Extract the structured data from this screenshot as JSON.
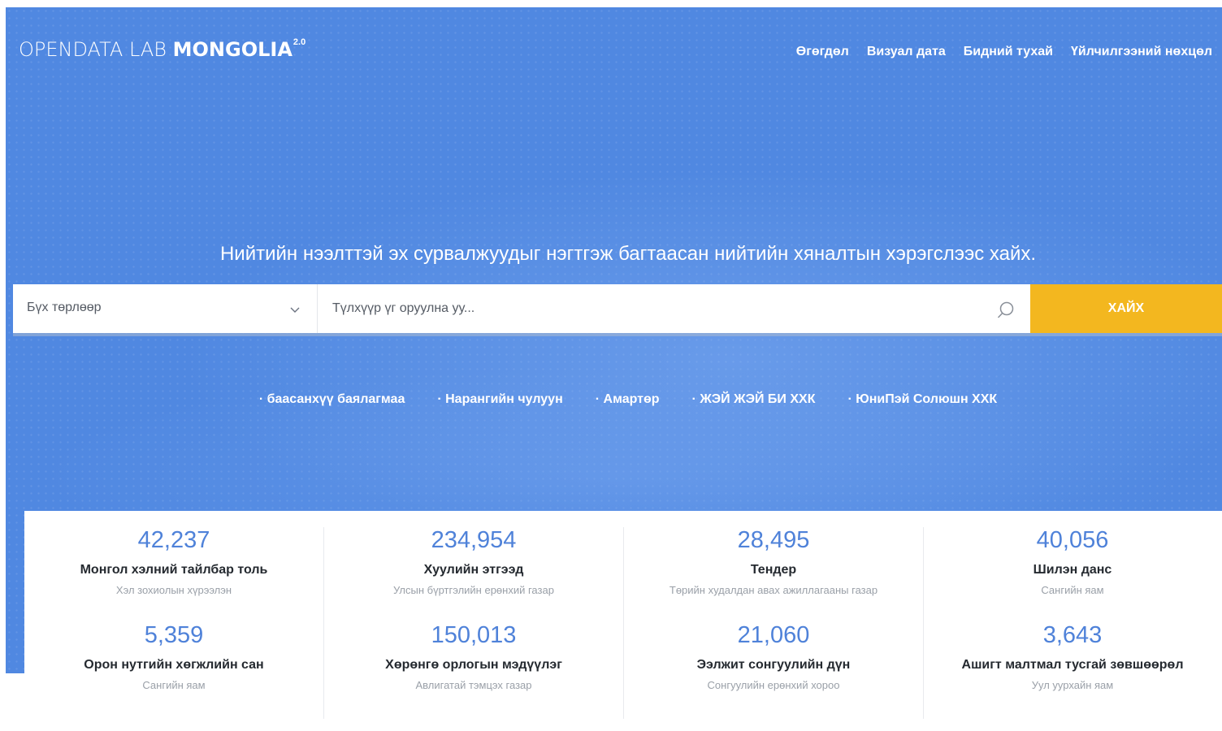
{
  "brand": {
    "light": "OPENDATA LAB ",
    "bold": "MONGOLIA",
    "version": "2.0"
  },
  "nav": {
    "items": [
      "Өгөгдөл",
      "Визуал дата",
      "Бидний тухай",
      "Үйлчилгээний нөхцөл"
    ]
  },
  "hero": {
    "tagline": "Нийтийн нээлттэй эх сурвалжуудыг нэгтгэж багтаасан нийтийн хяналтын хэрэгслээс хайх."
  },
  "search": {
    "category_value": "Бүх төрлөөр",
    "placeholder": "Түлхүүр үг оруулна уу...",
    "button_label": "ХАЙХ"
  },
  "suggestions": [
    "· баасанхүү баялагмаа",
    "· Нарангийн чулуун",
    "· Амартөр",
    "· ЖЭЙ ЖЭЙ БИ ХХК",
    "· ЮниПэй Солюшн ХХК"
  ],
  "stats": [
    {
      "number": "42,237",
      "title": "Монгол хэлний тайлбар толь",
      "source": "Хэл зохиолын хүрээлэн"
    },
    {
      "number": "5,359",
      "title": "Орон нутгийн хөгжлийн сан",
      "source": "Сангийн яам"
    },
    {
      "number": "234,954",
      "title": "Хуулийн этгээд",
      "source": "Улсын бүртгэлийн ерөнхий газар"
    },
    {
      "number": "150,013",
      "title": "Хөрөнгө орлогын мэдүүлэг",
      "source": "Авлигатай тэмцэх газар"
    },
    {
      "number": "28,495",
      "title": "Тендер",
      "source": "Төрийн худалдан авах ажиллагааны газар"
    },
    {
      "number": "21,060",
      "title": "Ээлжит сонгуулийн дүн",
      "source": "Сонгуулийн ерөнхий хороо"
    },
    {
      "number": "40,056",
      "title": "Шилэн данс",
      "source": "Сангийн яам"
    },
    {
      "number": "3,643",
      "title": "Ашигт малтмал тусгай зөвшөөрөл",
      "source": "Уул уурхайн яам"
    }
  ],
  "colors": {
    "hero_bg": "#5088e1",
    "accent_button": "#f3b71f",
    "stat_number": "#4f82d9"
  }
}
